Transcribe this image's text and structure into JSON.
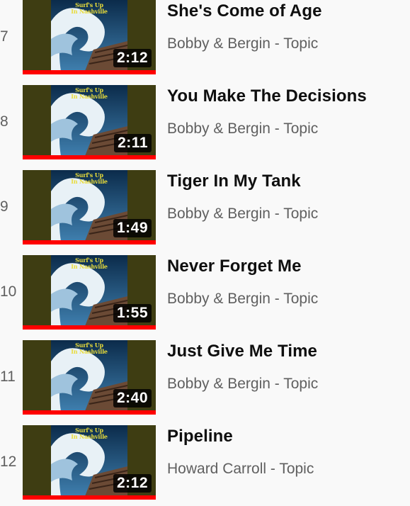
{
  "colors": {
    "background": "#f9f9f9",
    "progress_bar": "#ff0000",
    "title_text": "#0f0f0f",
    "secondary_text": "#606060",
    "thumbnail_bg": "#3e3d12"
  },
  "playlist": {
    "items": [
      {
        "index": "7",
        "title": "She's Come of Age",
        "channel": "Bobby & Bergin - Topic",
        "duration": "2:12",
        "thumb_art_text": "Surf's Up\nIn Nashville",
        "watched_fraction": 1.0
      },
      {
        "index": "8",
        "title": "You Make The Decisions",
        "channel": "Bobby & Bergin - Topic",
        "duration": "2:11",
        "thumb_art_text": "Surf's Up\nIn Nashville",
        "watched_fraction": 1.0
      },
      {
        "index": "9",
        "title": "Tiger In My Tank",
        "channel": "Bobby & Bergin - Topic",
        "duration": "1:49",
        "thumb_art_text": "Surf's Up\nIn Nashville",
        "watched_fraction": 1.0
      },
      {
        "index": "10",
        "title": "Never Forget Me",
        "channel": "Bobby & Bergin - Topic",
        "duration": "1:55",
        "thumb_art_text": "Surf's Up\nIn Nashville",
        "watched_fraction": 1.0
      },
      {
        "index": "11",
        "title": "Just Give Me Time",
        "channel": "Bobby & Bergin - Topic",
        "duration": "2:40",
        "thumb_art_text": "Surf's Up\nIn Nashville",
        "watched_fraction": 1.0
      },
      {
        "index": "12",
        "title": "Pipeline",
        "channel": "Howard Carroll - Topic",
        "duration": "2:12",
        "thumb_art_text": "Surf's Up\nIn Nashville",
        "watched_fraction": 1.0
      }
    ]
  }
}
